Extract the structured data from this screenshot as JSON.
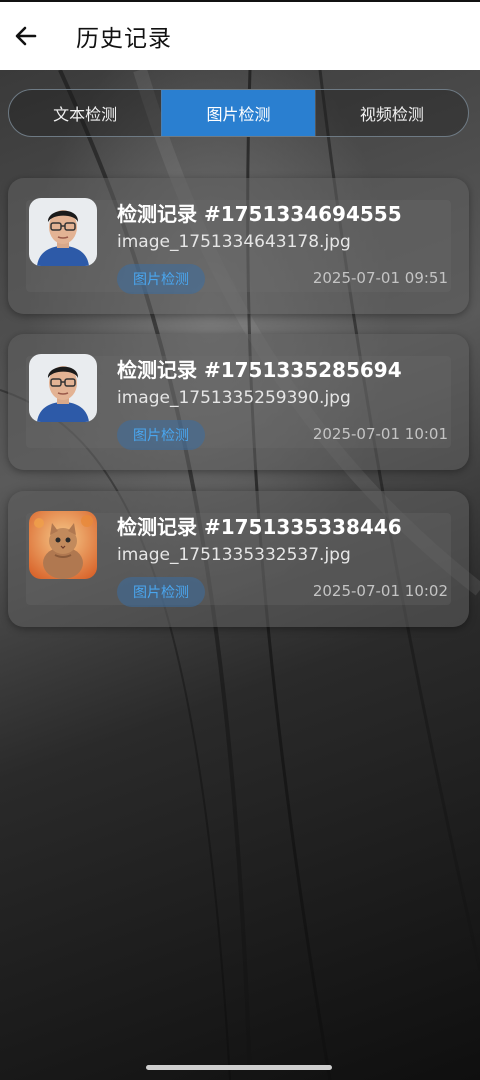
{
  "header": {
    "title": "历史记录",
    "back_icon": "arrow-left-icon"
  },
  "tabs": [
    {
      "label": "文本检测",
      "active": false
    },
    {
      "label": "图片检测",
      "active": true
    },
    {
      "label": "视频检测",
      "active": false
    }
  ],
  "records": [
    {
      "title": "检测记录 #1751334694555",
      "file": "image_1751334643178.jpg",
      "badge": "图片检测",
      "time": "2025-07-01 09:51",
      "thumb": "person-photo"
    },
    {
      "title": "检测记录 #1751335285694",
      "file": "image_1751335259390.jpg",
      "badge": "图片检测",
      "time": "2025-07-01 10:01",
      "thumb": "person-photo"
    },
    {
      "title": "检测记录 #1751335338446",
      "file": "image_1751335332537.jpg",
      "badge": "图片检测",
      "time": "2025-07-01 10:02",
      "thumb": "cat-photo"
    }
  ],
  "colors": {
    "accent": "#2a7fd0",
    "badge_text": "#4aa6ef",
    "card_bg": "#5f5f5f"
  }
}
